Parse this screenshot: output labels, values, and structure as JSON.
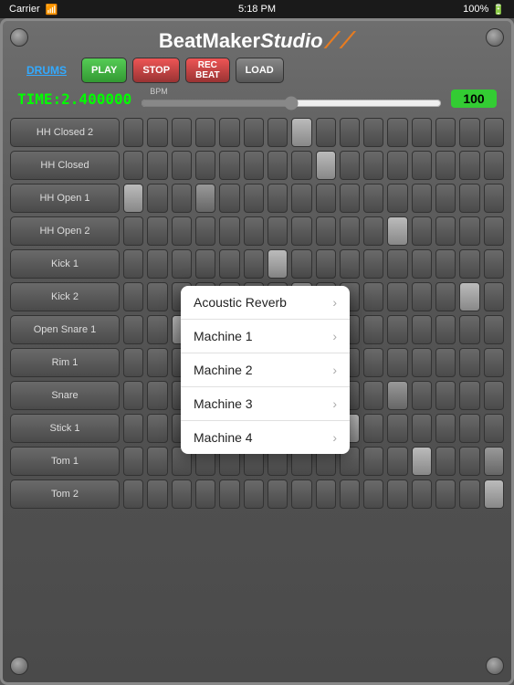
{
  "status_bar": {
    "carrier": "Carrier",
    "wifi_icon": "wifi-icon",
    "time": "5:18 PM",
    "battery": "100%"
  },
  "header": {
    "logo_beat": "BeatMaker",
    "logo_studio": "Studio",
    "logo_swirl": ")))"
  },
  "toolbar": {
    "drums_label": "DRUMS",
    "play_label": "PLAY",
    "stop_label": "STOP",
    "rec_label": "REC\nBEAT",
    "load_label": "LOAD"
  },
  "bpm_area": {
    "time_label": "TIME:2.400000",
    "bpm_label": "BPM",
    "bpm_value": "100",
    "slider_min": 0,
    "slider_max": 200,
    "slider_val": 100
  },
  "rows": [
    {
      "label": "HH Closed 2"
    },
    {
      "label": "HH Closed"
    },
    {
      "label": "HH Open 1"
    },
    {
      "label": "HH Open 2"
    },
    {
      "label": "Kick 1"
    },
    {
      "label": "Kick 2"
    },
    {
      "label": "Open Snare 1"
    },
    {
      "label": "Rim 1"
    },
    {
      "label": "Snare"
    },
    {
      "label": "Stick 1"
    },
    {
      "label": "Tom 1"
    },
    {
      "label": "Tom 2"
    }
  ],
  "grid": {
    "columns": 16,
    "active_cells": [
      [
        2,
        3
      ],
      [
        4,
        6
      ],
      [
        1,
        8
      ],
      [
        3,
        11
      ],
      [
        5,
        14
      ],
      [
        2,
        0
      ],
      [
        6,
        2
      ],
      [
        7,
        4
      ],
      [
        9,
        9
      ],
      [
        10,
        12
      ],
      [
        11,
        15
      ],
      [
        0,
        7
      ]
    ]
  },
  "dropdown": {
    "items": [
      {
        "label": "Acoustic Reverb",
        "has_arrow": true
      },
      {
        "label": "Machine 1",
        "has_arrow": true
      },
      {
        "label": "Machine 2",
        "has_arrow": true
      },
      {
        "label": "Machine 3",
        "has_arrow": true
      },
      {
        "label": "Machine 4",
        "has_arrow": true
      }
    ]
  },
  "corner_screws": [
    "top-left",
    "top-right",
    "bottom-left",
    "bottom-right"
  ]
}
